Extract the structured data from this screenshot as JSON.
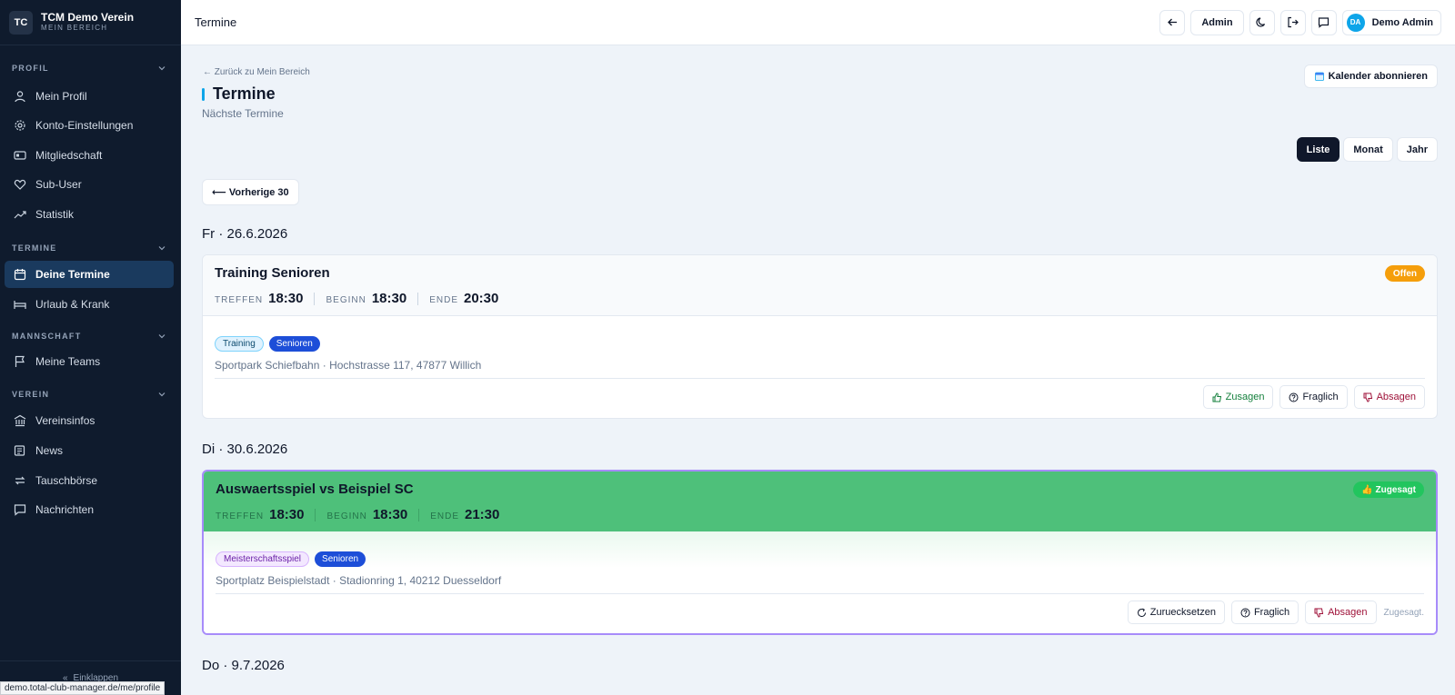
{
  "brand": {
    "logo": "TC",
    "name": "TCM Demo Verein",
    "subtitle": "MEIN BEREICH"
  },
  "sidebar": {
    "sections": [
      {
        "label": "PROFIL"
      },
      {
        "label": "TERMINE"
      },
      {
        "label": "MANNSCHAFT"
      },
      {
        "label": "VEREIN"
      }
    ],
    "items": [
      {
        "label": "Mein Profil",
        "icon": "user-icon"
      },
      {
        "label": "Konto-Einstellungen",
        "icon": "gear-icon"
      },
      {
        "label": "Mitgliedschaft",
        "icon": "id-card-icon"
      },
      {
        "label": "Sub-User",
        "icon": "heart-icon"
      },
      {
        "label": "Statistik",
        "icon": "trend-icon"
      },
      {
        "label": "Deine Termine",
        "icon": "calendar-icon",
        "active": true
      },
      {
        "label": "Urlaub & Krank",
        "icon": "bed-icon"
      },
      {
        "label": "Meine Teams",
        "icon": "flag-icon"
      },
      {
        "label": "Vereinsinfos",
        "icon": "building-icon"
      },
      {
        "label": "News",
        "icon": "newspaper-icon"
      },
      {
        "label": "Tauschbörse",
        "icon": "swap-icon"
      },
      {
        "label": "Nachrichten",
        "icon": "message-icon"
      }
    ],
    "collapse_label": "Einklappen",
    "status_url": "demo.total-club-manager.de/me/profile"
  },
  "topbar": {
    "title": "Termine",
    "admin_label": "Admin",
    "user": {
      "initials": "DA",
      "name": "Demo Admin"
    }
  },
  "page": {
    "back_link": "← Zurück zu Mein Bereich",
    "title": "Termine",
    "subtitle": "Nächste Termine",
    "subscribe_label": "Kalender abonnieren",
    "views": [
      "Liste",
      "Monat",
      "Jahr"
    ],
    "active_view": "Liste",
    "prev_label": "⟵ Vorherige 30"
  },
  "events": [
    {
      "date": "Fr · 26.6.2026",
      "title": "Training Senioren",
      "status": "Offen",
      "times": [
        {
          "label": "TREFFEN",
          "value": "18:30"
        },
        {
          "label": "BEGINN",
          "value": "18:30"
        },
        {
          "label": "ENDE",
          "value": "20:30"
        }
      ],
      "tags": [
        "Training",
        "Senioren"
      ],
      "location": "Sportpark Schiefbahn · Hochstrasse 117, 47877 Willich",
      "actions": [
        "Zusagen",
        "Fraglich",
        "Absagen"
      ]
    },
    {
      "date": "Di · 30.6.2026",
      "title": "Auswaertsspiel vs Beispiel SC",
      "status": "👍 Zugesagt",
      "times": [
        {
          "label": "TREFFEN",
          "value": "18:30"
        },
        {
          "label": "BEGINN",
          "value": "18:30"
        },
        {
          "label": "ENDE",
          "value": "21:30"
        }
      ],
      "tags": [
        "Meisterschaftsspiel",
        "Senioren"
      ],
      "location": "Sportplatz Beispielstadt · Stadionring 1, 40212 Duesseldorf",
      "actions": [
        "Zuruecksetzen",
        "Fraglich",
        "Absagen"
      ],
      "note": "Zugesagt."
    },
    {
      "date": "Do · 9.7.2026"
    }
  ],
  "colors": {
    "sidebar_bg": "#0f1b2d",
    "accepted_bg": "#4ec07a",
    "open_badge": "#f59e0b",
    "accepted_border": "#a78bfa"
  }
}
